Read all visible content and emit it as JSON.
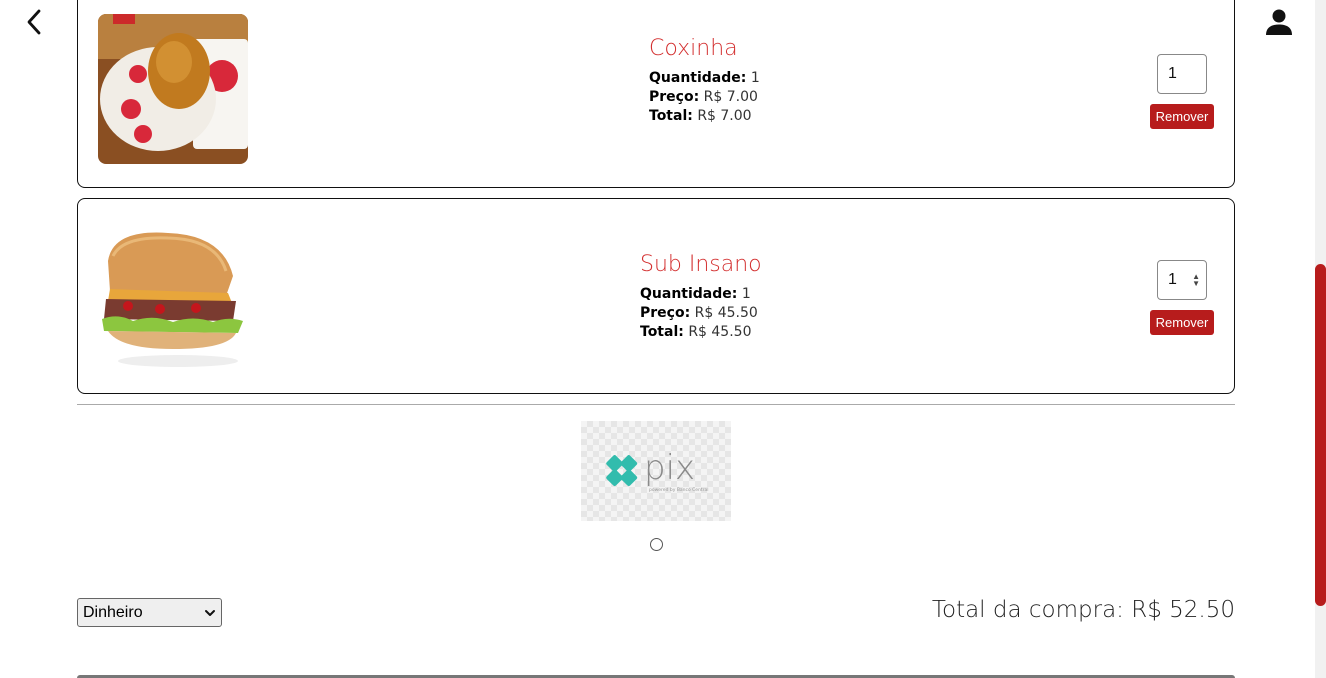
{
  "header": {
    "back_icon": "chevron-left-icon",
    "user_icon": "person-icon"
  },
  "cart": {
    "items": [
      {
        "name": "Coxinha",
        "image": "coxinha-photo",
        "quantity_label": "Quantidade:",
        "quantity_value": "1",
        "price_label": "Preço:",
        "price_value": "R$ 7.00",
        "total_label": "Total:",
        "total_value": "R$ 7.00",
        "qty_input": "1",
        "remove_label": "Remover"
      },
      {
        "name": "Sub Insano",
        "image": "sandwich-photo",
        "quantity_label": "Quantidade:",
        "quantity_value": "1",
        "price_label": "Preço:",
        "price_value": "R$ 45.50",
        "total_label": "Total:",
        "total_value": "R$ 45.50",
        "qty_input": "1",
        "remove_label": "Remover"
      }
    ]
  },
  "payment": {
    "pix_logo_text": "pix",
    "pix_logo_subtext": "powered by Banco Central",
    "method_selected": "Dinheiro"
  },
  "summary": {
    "total_text": "Total da compra: R$ 52.50"
  },
  "colors": {
    "accent": "#b71c1c",
    "item_name": "#d32f2f",
    "pix": "#32bcad"
  }
}
